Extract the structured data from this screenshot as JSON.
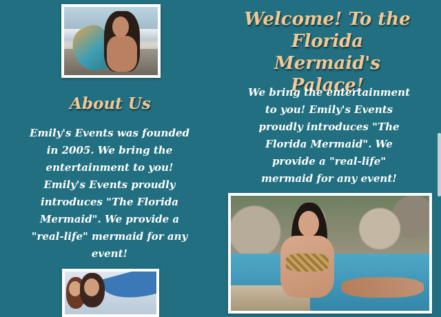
{
  "hero": {
    "title": "Welcome! To the Florida Mermaid's Palace!",
    "intro": "We bring the entertainment to you! Emily's Events proudly introduces \"The Florida Mermaid\". We provide a \"real-life\" mermaid for any event!"
  },
  "about": {
    "title": "About Us",
    "body": "Emily's Events was founded in 2005. We bring the entertainment to you! Emily's Events proudly introduces \"The Florida Mermaid\". We provide a \"real-life\" mermaid for any event!"
  },
  "colors": {
    "background": "#216f80",
    "heading": "#f2c795",
    "text": "#ffffff"
  }
}
